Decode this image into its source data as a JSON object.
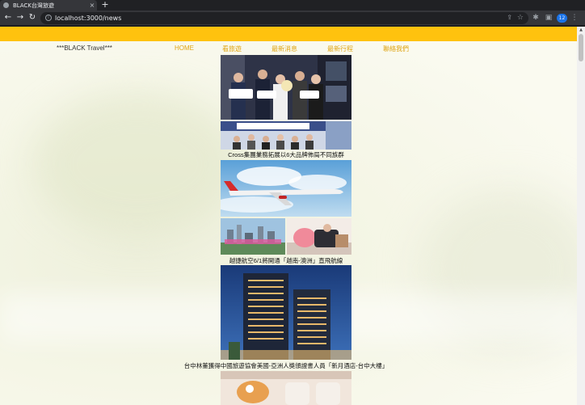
{
  "browser": {
    "tab_title": "BLACK台灣旅遊",
    "tab_close": "×",
    "new_tab": "+",
    "url": "localhost:3000/news",
    "avatar_initials": "12"
  },
  "site": {
    "brand": "***BLACK Travel***",
    "nav": [
      "HOME",
      "看旅遊",
      "最新消息",
      "最新行程",
      "聯絡我們"
    ],
    "accent_color": "#ffc20e"
  },
  "articles": [
    {
      "caption": "Cross集團業務拓展以6大品牌佈局不同族群"
    },
    {
      "caption": "越捷航空6/1將開通「越南-澳洲」直飛航線"
    },
    {
      "caption": "台中林董獲得中國旅遊協會美國-亞洲人獎頒證書人員「新月酒店-台中大樓」"
    }
  ]
}
